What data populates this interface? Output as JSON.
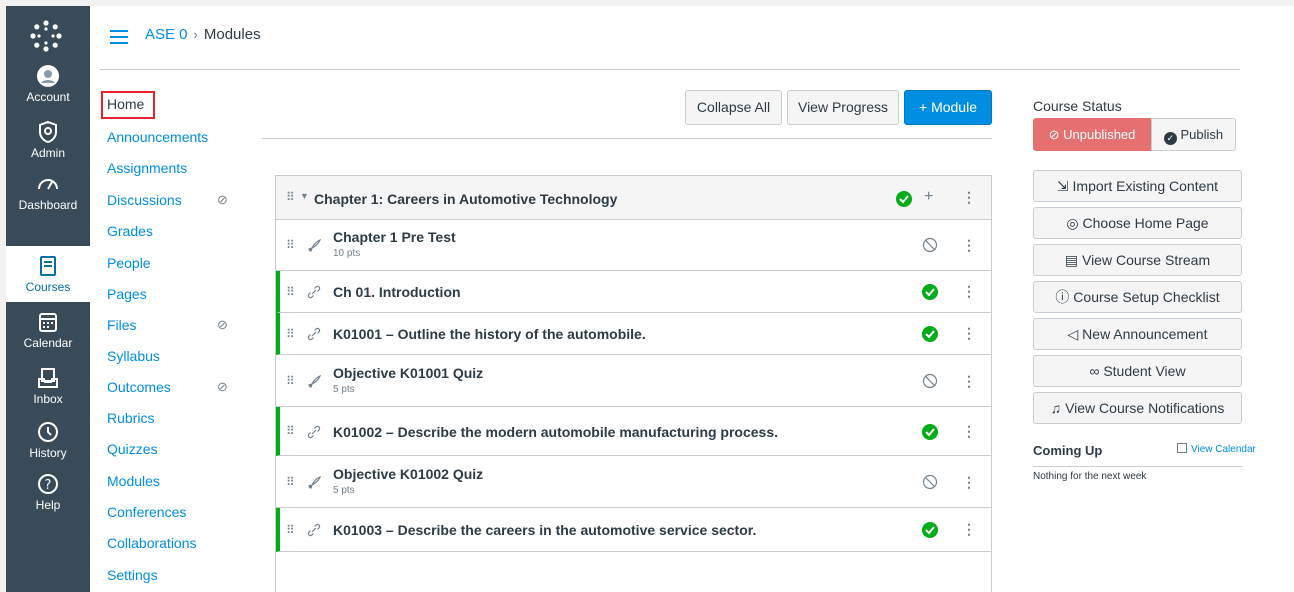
{
  "global_nav": {
    "items": [
      {
        "label": "Account",
        "icon": "account-icon"
      },
      {
        "label": "Admin",
        "icon": "shield-icon"
      },
      {
        "label": "Dashboard",
        "icon": "dashboard-icon"
      },
      {
        "label": "Courses",
        "icon": "book-icon"
      },
      {
        "label": "Calendar",
        "icon": "calendar-icon"
      },
      {
        "label": "Inbox",
        "icon": "inbox-icon"
      },
      {
        "label": "History",
        "icon": "clock-icon"
      },
      {
        "label": "Help",
        "icon": "help-icon"
      }
    ]
  },
  "breadcrumb": {
    "course": "ASE 0",
    "separator": "›",
    "page": "Modules"
  },
  "course_nav": {
    "items": [
      {
        "label": "Home"
      },
      {
        "label": "Announcements"
      },
      {
        "label": "Assignments"
      },
      {
        "label": "Discussions",
        "hidden": true
      },
      {
        "label": "Grades"
      },
      {
        "label": "People"
      },
      {
        "label": "Pages"
      },
      {
        "label": "Files",
        "hidden": true
      },
      {
        "label": "Syllabus"
      },
      {
        "label": "Outcomes",
        "hidden": true
      },
      {
        "label": "Rubrics"
      },
      {
        "label": "Quizzes"
      },
      {
        "label": "Modules"
      },
      {
        "label": "Conferences"
      },
      {
        "label": "Collaborations"
      },
      {
        "label": "Settings"
      }
    ]
  },
  "toolbar": {
    "collapse_all": "Collapse All",
    "view_progress": "View Progress",
    "add_module": "+ Module"
  },
  "module": {
    "title": "Chapter 1: Careers in Automotive Technology",
    "items": [
      {
        "title": "Chapter 1 Pre Test",
        "sub": "10 pts",
        "type": "quiz",
        "published": false
      },
      {
        "title": "Ch 01. Introduction",
        "sub": "",
        "type": "link",
        "published": true
      },
      {
        "title": "K01001 – Outline the history of the automobile.",
        "sub": "",
        "type": "link",
        "published": true
      },
      {
        "title": "Objective K01001 Quiz",
        "sub": "5 pts",
        "type": "quiz",
        "published": false
      },
      {
        "title": "K01002 – Describe the modern automobile manufacturing process.",
        "sub": "",
        "type": "link",
        "published": true
      },
      {
        "title": "Objective K01002 Quiz",
        "sub": "5 pts",
        "type": "quiz",
        "published": false
      },
      {
        "title": "K01003 – Describe the careers in the automotive service sector.",
        "sub": "",
        "type": "link",
        "published": true
      }
    ]
  },
  "sidebar": {
    "course_status": "Course Status",
    "unpublished": "Unpublished",
    "publish": "Publish",
    "buttons": [
      {
        "label": "Import Existing Content",
        "icon": "import-icon"
      },
      {
        "label": "Choose Home Page",
        "icon": "target-icon"
      },
      {
        "label": "View Course Stream",
        "icon": "stream-icon"
      },
      {
        "label": "Course Setup Checklist",
        "icon": "help-circle-icon"
      },
      {
        "label": "New Announcement",
        "icon": "megaphone-icon"
      },
      {
        "label": "Student View",
        "icon": "glasses-icon"
      },
      {
        "label": "View Course Notifications",
        "icon": "bell-icon"
      }
    ],
    "coming_up": "Coming Up",
    "view_calendar": "View Calendar",
    "nothing": "Nothing for the next week"
  },
  "colors": {
    "nav_bg": "#394b58",
    "link": "#008ee2",
    "published": "#00ac18",
    "unpublished": "#e66f70",
    "highlight": "#e8232f"
  }
}
